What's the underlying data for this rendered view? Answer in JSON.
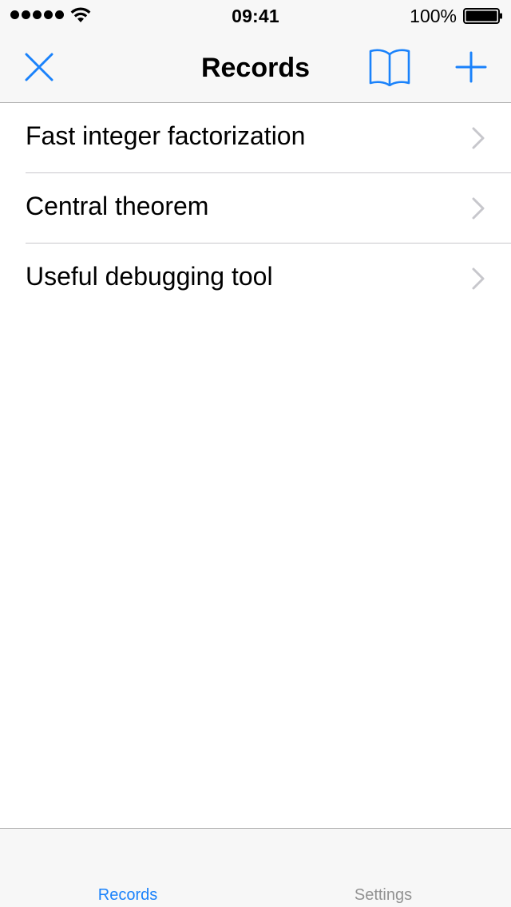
{
  "status_bar": {
    "time": "09:41",
    "battery_percent": "100%",
    "signal_bars": 5,
    "battery_level": 1.0
  },
  "nav": {
    "title": "Records",
    "left_icon": "close-icon",
    "right_icons": [
      "book-icon",
      "plus-icon"
    ],
    "accent_color": "#1a82fb"
  },
  "records": [
    {
      "label": "Fast integer factorization"
    },
    {
      "label": "Central theorem"
    },
    {
      "label": "Useful debugging tool"
    }
  ],
  "tab_bar": {
    "tabs": [
      {
        "label": "Records",
        "selected": true
      },
      {
        "label": "Settings",
        "selected": false
      }
    ],
    "selected_color": "#1a82fb",
    "unselected_color": "#929292"
  }
}
